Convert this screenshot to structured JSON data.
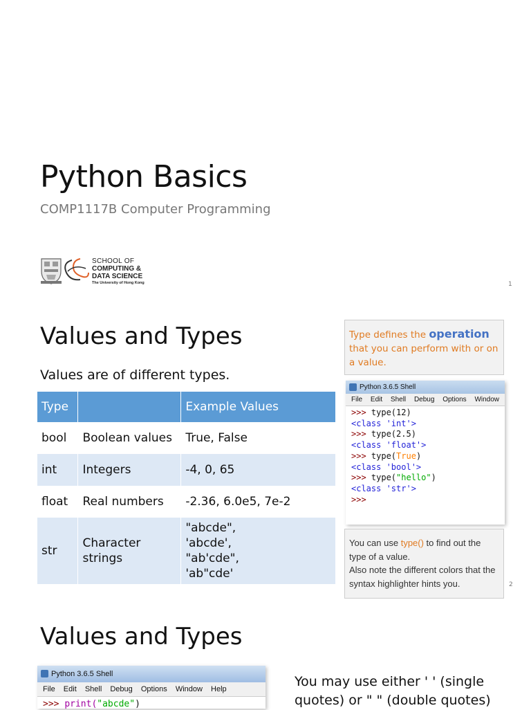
{
  "slide1": {
    "title": "Python Basics",
    "subtitle": "COMP1117B Computer Programming",
    "logo": {
      "line1": "SCHOOL OF",
      "line2": "COMPUTING &",
      "line3": "DATA SCIENCE",
      "line4": "The University of Hong Kong"
    },
    "page_number": "1"
  },
  "slide2": {
    "heading": "Values and Types",
    "intro": "Values are of different types.",
    "table": {
      "headers": [
        "Type",
        "",
        "Example Values"
      ],
      "rows": [
        {
          "type": "bool",
          "desc": "Boolean values",
          "examples": "True, False"
        },
        {
          "type": "int",
          "desc": "Integers",
          "examples": "-4, 0, 65"
        },
        {
          "type": "float",
          "desc": "Real numbers",
          "examples": "-2.36, 6.0e5, 7e-2"
        },
        {
          "type": "str",
          "desc_l1": "Character",
          "desc_l2": "strings",
          "ex_l1": "\"abcde\",",
          "ex_l2": "'abcde',",
          "ex_l3": "\"ab'cde\",",
          "ex_l4": "'ab\"cde'"
        }
      ]
    },
    "callout_top": {
      "pre": "Type defines the ",
      "emphasis": "operation",
      "post": " that you can perform with or on a value."
    },
    "shell": {
      "title": "Python 3.6.5 Shell",
      "menu": [
        "File",
        "Edit",
        "Shell",
        "Debug",
        "Options",
        "Window"
      ],
      "lines": {
        "p1": ">>> ",
        "c1": "type(12)",
        "o1": "<class 'int'>",
        "p2": ">>> ",
        "c2": "type(2.5)",
        "o2": "<class 'float'>",
        "p3": ">>> ",
        "c3a": "type(",
        "c3kw": "True",
        "c3b": ")",
        "o3": "<class 'bool'>",
        "p4": ">>> ",
        "c4a": "type(",
        "c4str": "\"hello\"",
        "c4b": ")",
        "o4": "<class 'str'>",
        "p5": ">>>"
      }
    },
    "callout_bottom": {
      "pre": "You can use ",
      "fn": "type()",
      "post": " to find out the type of a value.",
      "line2": "Also note the different colors that the syntax highlighter hints you."
    },
    "page_number": "2"
  },
  "slide3": {
    "heading": "Values and Types",
    "shell": {
      "title": "Python 3.6.5 Shell",
      "menu": [
        "File",
        "Edit",
        "Shell",
        "Debug",
        "Options",
        "Window",
        "Help"
      ],
      "p1": ">>> ",
      "c1a": "print(",
      "c1str": "\"abcde\"",
      "c1b": ")"
    },
    "text": "You may use either ' ' (single quotes) or \" \" (double quotes)"
  },
  "colors": {
    "table_header": "#5b9bd5",
    "table_band": "#dde8f5",
    "callout_orange": "#e07b22",
    "callout_blue": "#4472c4"
  }
}
